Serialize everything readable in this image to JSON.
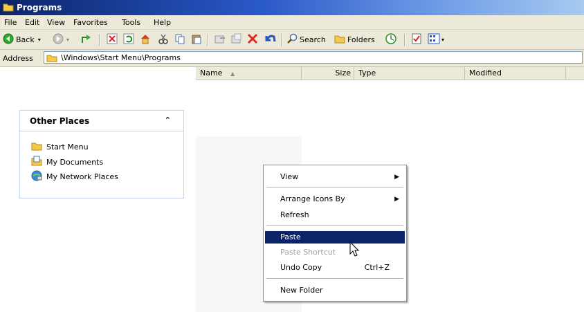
{
  "window": {
    "title": "Programs"
  },
  "menubar": {
    "items": [
      {
        "label": "File"
      },
      {
        "label": "Edit"
      },
      {
        "label": "View"
      },
      {
        "label": "Favorites"
      },
      {
        "label": "Tools"
      },
      {
        "label": "Help"
      }
    ]
  },
  "toolbar": {
    "back_label": "Back",
    "search_label": "Search",
    "folders_label": "Folders"
  },
  "address": {
    "label": "Address",
    "value": "\\Windows\\Start Menu\\Programs"
  },
  "columns": [
    {
      "label": "Name"
    },
    {
      "label": "Size"
    },
    {
      "label": "Type"
    },
    {
      "label": "Modified"
    }
  ],
  "other_places": {
    "title": "Other Places",
    "items": [
      {
        "label": "Start Menu",
        "icon": "folder-icon"
      },
      {
        "label": "My Documents",
        "icon": "my-documents-icon"
      },
      {
        "label": "My Network Places",
        "icon": "network-places-icon"
      }
    ]
  },
  "context_menu": {
    "items": [
      {
        "label": "View",
        "submenu": true
      },
      {
        "label": "Arrange Icons By",
        "submenu": true
      },
      {
        "label": "Refresh"
      },
      {
        "label": "Paste",
        "highlighted": true
      },
      {
        "label": "Paste Shortcut",
        "disabled": true
      },
      {
        "label": "Undo Copy",
        "shortcut": "Ctrl+Z"
      },
      {
        "label": "New Folder"
      }
    ]
  },
  "colors": {
    "titlebar_dark": "#0a246a",
    "highlight": "#0a246a",
    "chrome": "#ece9d8"
  }
}
